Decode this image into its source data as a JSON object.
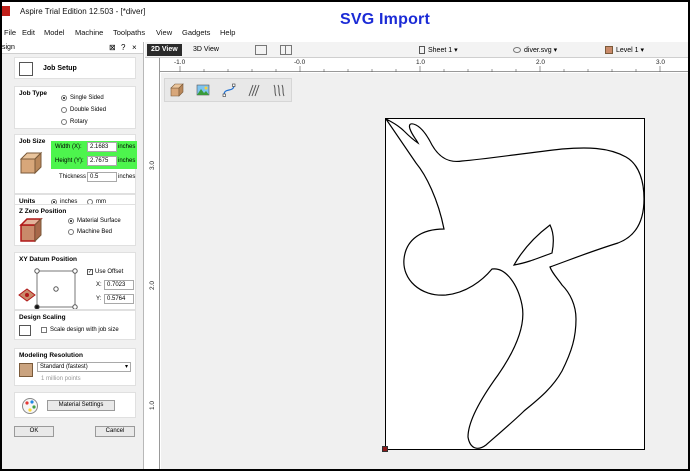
{
  "window": {
    "title": "Aspire Trial Edition 12.503 - [*diver]",
    "overlay_caption": "SVG Import"
  },
  "menu": [
    "File",
    "Edit",
    "Model",
    "Machine",
    "Toolpaths",
    "View",
    "Gadgets",
    "Help"
  ],
  "panel": {
    "header": "sign",
    "job_setup_title": "Job Setup",
    "job_type": {
      "title": "Job Type",
      "options": [
        "Single Sided",
        "Double Sided",
        "Rotary"
      ],
      "selected": "Single Sided"
    },
    "job_size": {
      "title": "Job Size",
      "width_label": "Width (X):",
      "width_value": "2.1683",
      "height_label": "Height (Y):",
      "height_value": "2.7675",
      "thickness_label": "Thickness",
      "thickness_value": "0.5",
      "unit": "inches"
    },
    "units": {
      "title": "Units",
      "options": [
        "inches",
        "mm"
      ],
      "selected": "inches"
    },
    "z_zero": {
      "title": "Z Zero Position",
      "options": [
        "Material Surface",
        "Machine Bed"
      ],
      "selected": "Material Surface"
    },
    "xy_datum": {
      "title": "XY Datum Position",
      "use_offset_label": "Use Offset",
      "use_offset_checked": true,
      "x_label": "X:",
      "x_value": "0.7023",
      "y_label": "Y:",
      "y_value": "0.5764"
    },
    "design_scaling": {
      "title": "Design Scaling",
      "checkbox_label": "Scale design with job size"
    },
    "modeling_resolution": {
      "title": "Modeling Resolution",
      "selected": "Standard (fastest)",
      "note": "1 million points"
    },
    "material_settings_label": "Material Settings",
    "ok_label": "OK",
    "cancel_label": "Cancel"
  },
  "tabs": [
    "2D View",
    "3D View"
  ],
  "toolbar": {
    "sheet": "Sheet 1",
    "file": "diver.svg",
    "level": "Level 1"
  },
  "ruler": {
    "top_labels": [
      "-1.0",
      "-0.0",
      "1.0",
      "2.0",
      "3.0"
    ],
    "left_labels": [
      "3.0",
      "2.0",
      "1.0"
    ]
  },
  "colors": {
    "overlay": "#1b2bd6",
    "size_highlight": "#4df54d",
    "origin_marker": "#8b1a1a"
  }
}
